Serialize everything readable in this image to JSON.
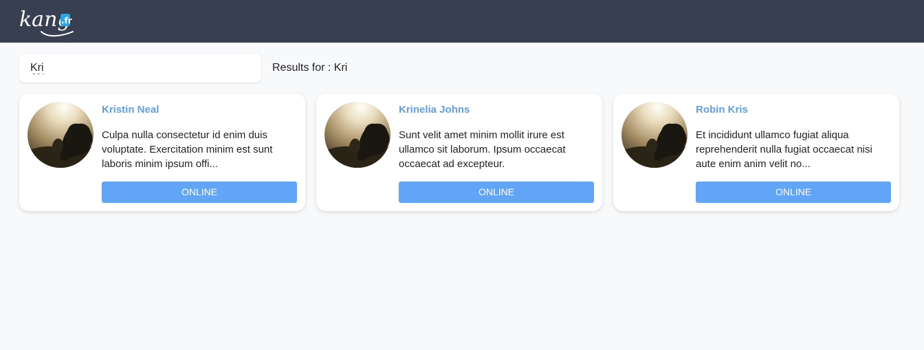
{
  "header": {
    "logo_text": "kang",
    "logo_badge": ".fr",
    "background": "#373f51"
  },
  "search": {
    "value": "Kri",
    "results_label": "Results for : Kri"
  },
  "results": [
    {
      "name": "Kristin Neal",
      "description": "Culpa nulla consectetur id enim duis voluptate. Exercitation minim est sunt laboris minim ipsum offi...",
      "status": "ONLINE",
      "avatar": "foggy-tree-photo"
    },
    {
      "name": "Krinelia Johns",
      "description": "Sunt velit amet minim mollit irure est ullamco sit laborum. Ipsum occaecat occaecat ad excepteur.",
      "status": "ONLINE",
      "avatar": "foggy-tree-photo"
    },
    {
      "name": "Robin Kris",
      "description": "Et incididunt ullamco fugiat aliqua reprehenderit nulla fugiat occaecat nisi aute enim anim velit no...",
      "status": "ONLINE",
      "avatar": "foggy-tree-photo"
    }
  ],
  "colors": {
    "accent": "#62a4f6",
    "name": "#5e9fe8",
    "page_background": "#f8f9fb"
  }
}
